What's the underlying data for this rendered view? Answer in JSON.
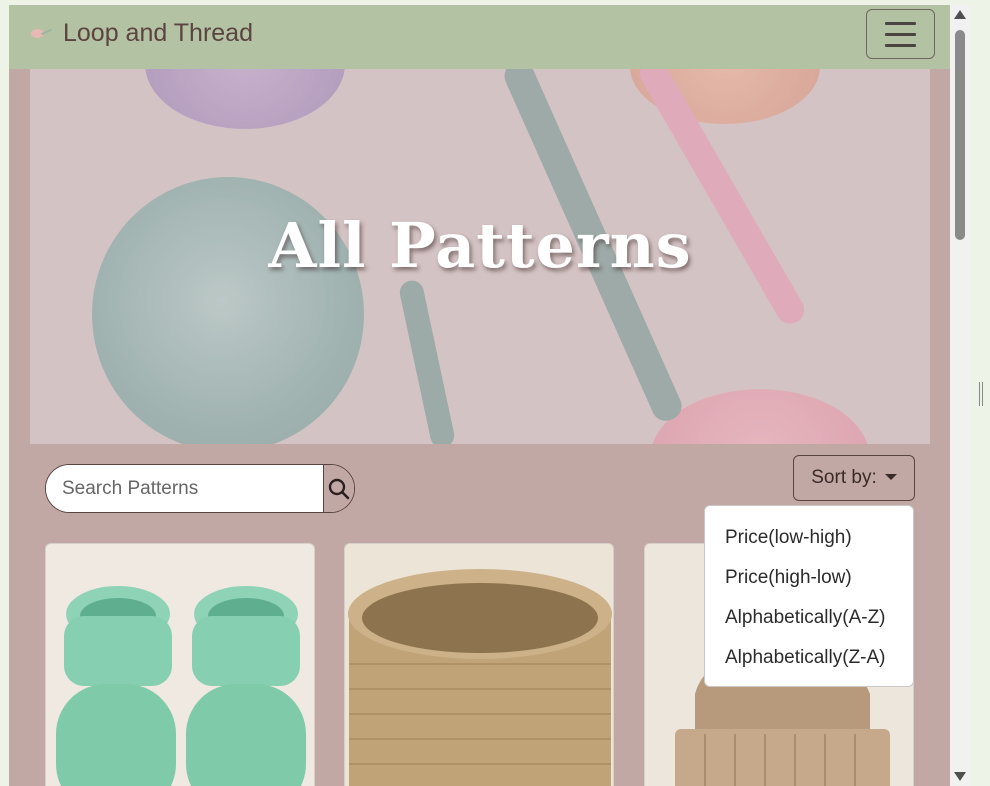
{
  "navbar": {
    "brand_name": "Loop and Thread",
    "menu_icon": "hamburger-menu-icon"
  },
  "hero": {
    "title": "All Patterns"
  },
  "search": {
    "placeholder": "Search Patterns",
    "button_icon": "search-icon"
  },
  "sort": {
    "label": "Sort by:",
    "options": [
      "Price(low-high)",
      "Price(high-low)",
      "Alphabetically(A-Z)",
      "Alphabetically(Z-A)"
    ]
  },
  "colors": {
    "navbar_bg": "#b3c2a3",
    "page_bg": "#c2a8a4",
    "text_brown": "#5b4440"
  }
}
